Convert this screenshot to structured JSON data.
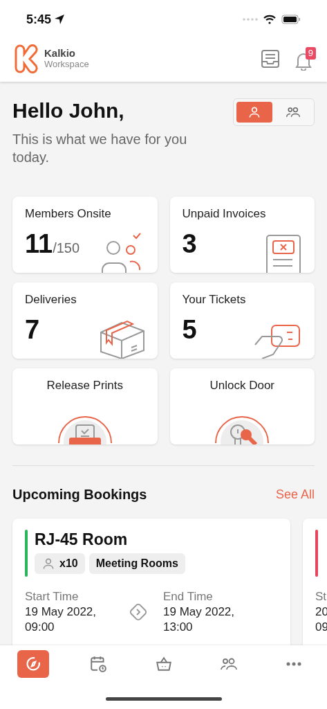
{
  "status_bar": {
    "time": "5:45"
  },
  "header": {
    "brand": "Kalkio",
    "subtitle": "Workspace",
    "notification_count": "9"
  },
  "greeting": {
    "title": "Hello John,",
    "subtitle": "This is what we have for you today."
  },
  "view_toggle": [
    {
      "kind": "person",
      "selected": true
    },
    {
      "kind": "group",
      "selected": false
    }
  ],
  "stats": [
    {
      "kind": "members",
      "label": "Members Onsite",
      "value": "11",
      "total": "/150"
    },
    {
      "kind": "invoices",
      "label": "Unpaid Invoices",
      "value": "3"
    },
    {
      "kind": "deliveries",
      "label": "Deliveries",
      "value": "7"
    },
    {
      "kind": "tickets",
      "label": "Your Tickets",
      "value": "5"
    }
  ],
  "actions": [
    {
      "kind": "print",
      "label": "Release Prints"
    },
    {
      "kind": "door",
      "label": "Unlock Door"
    }
  ],
  "bookings_section": {
    "title": "Upcoming Bookings",
    "link": "See All"
  },
  "bookings": [
    {
      "kind": "full",
      "color": "#2bb55a",
      "title": "RJ-45 Room",
      "capacity": "x10",
      "category": "Meeting Rooms",
      "start_label": "Start Time",
      "start_lines": [
        "19 May 2022,",
        "09:00"
      ],
      "end_label": "End Time",
      "end_lines": [
        "19 May 2022,",
        "13:00"
      ]
    },
    {
      "kind": "partial",
      "color": "#e8455c",
      "start_label": "St",
      "start_lines": [
        "20",
        "09"
      ]
    }
  ],
  "tab_bar": [
    {
      "kind": "explore",
      "selected": true
    },
    {
      "kind": "calendar",
      "selected": false
    },
    {
      "kind": "basket",
      "selected": false
    },
    {
      "kind": "people",
      "selected": false
    },
    {
      "kind": "more",
      "selected": false
    }
  ]
}
